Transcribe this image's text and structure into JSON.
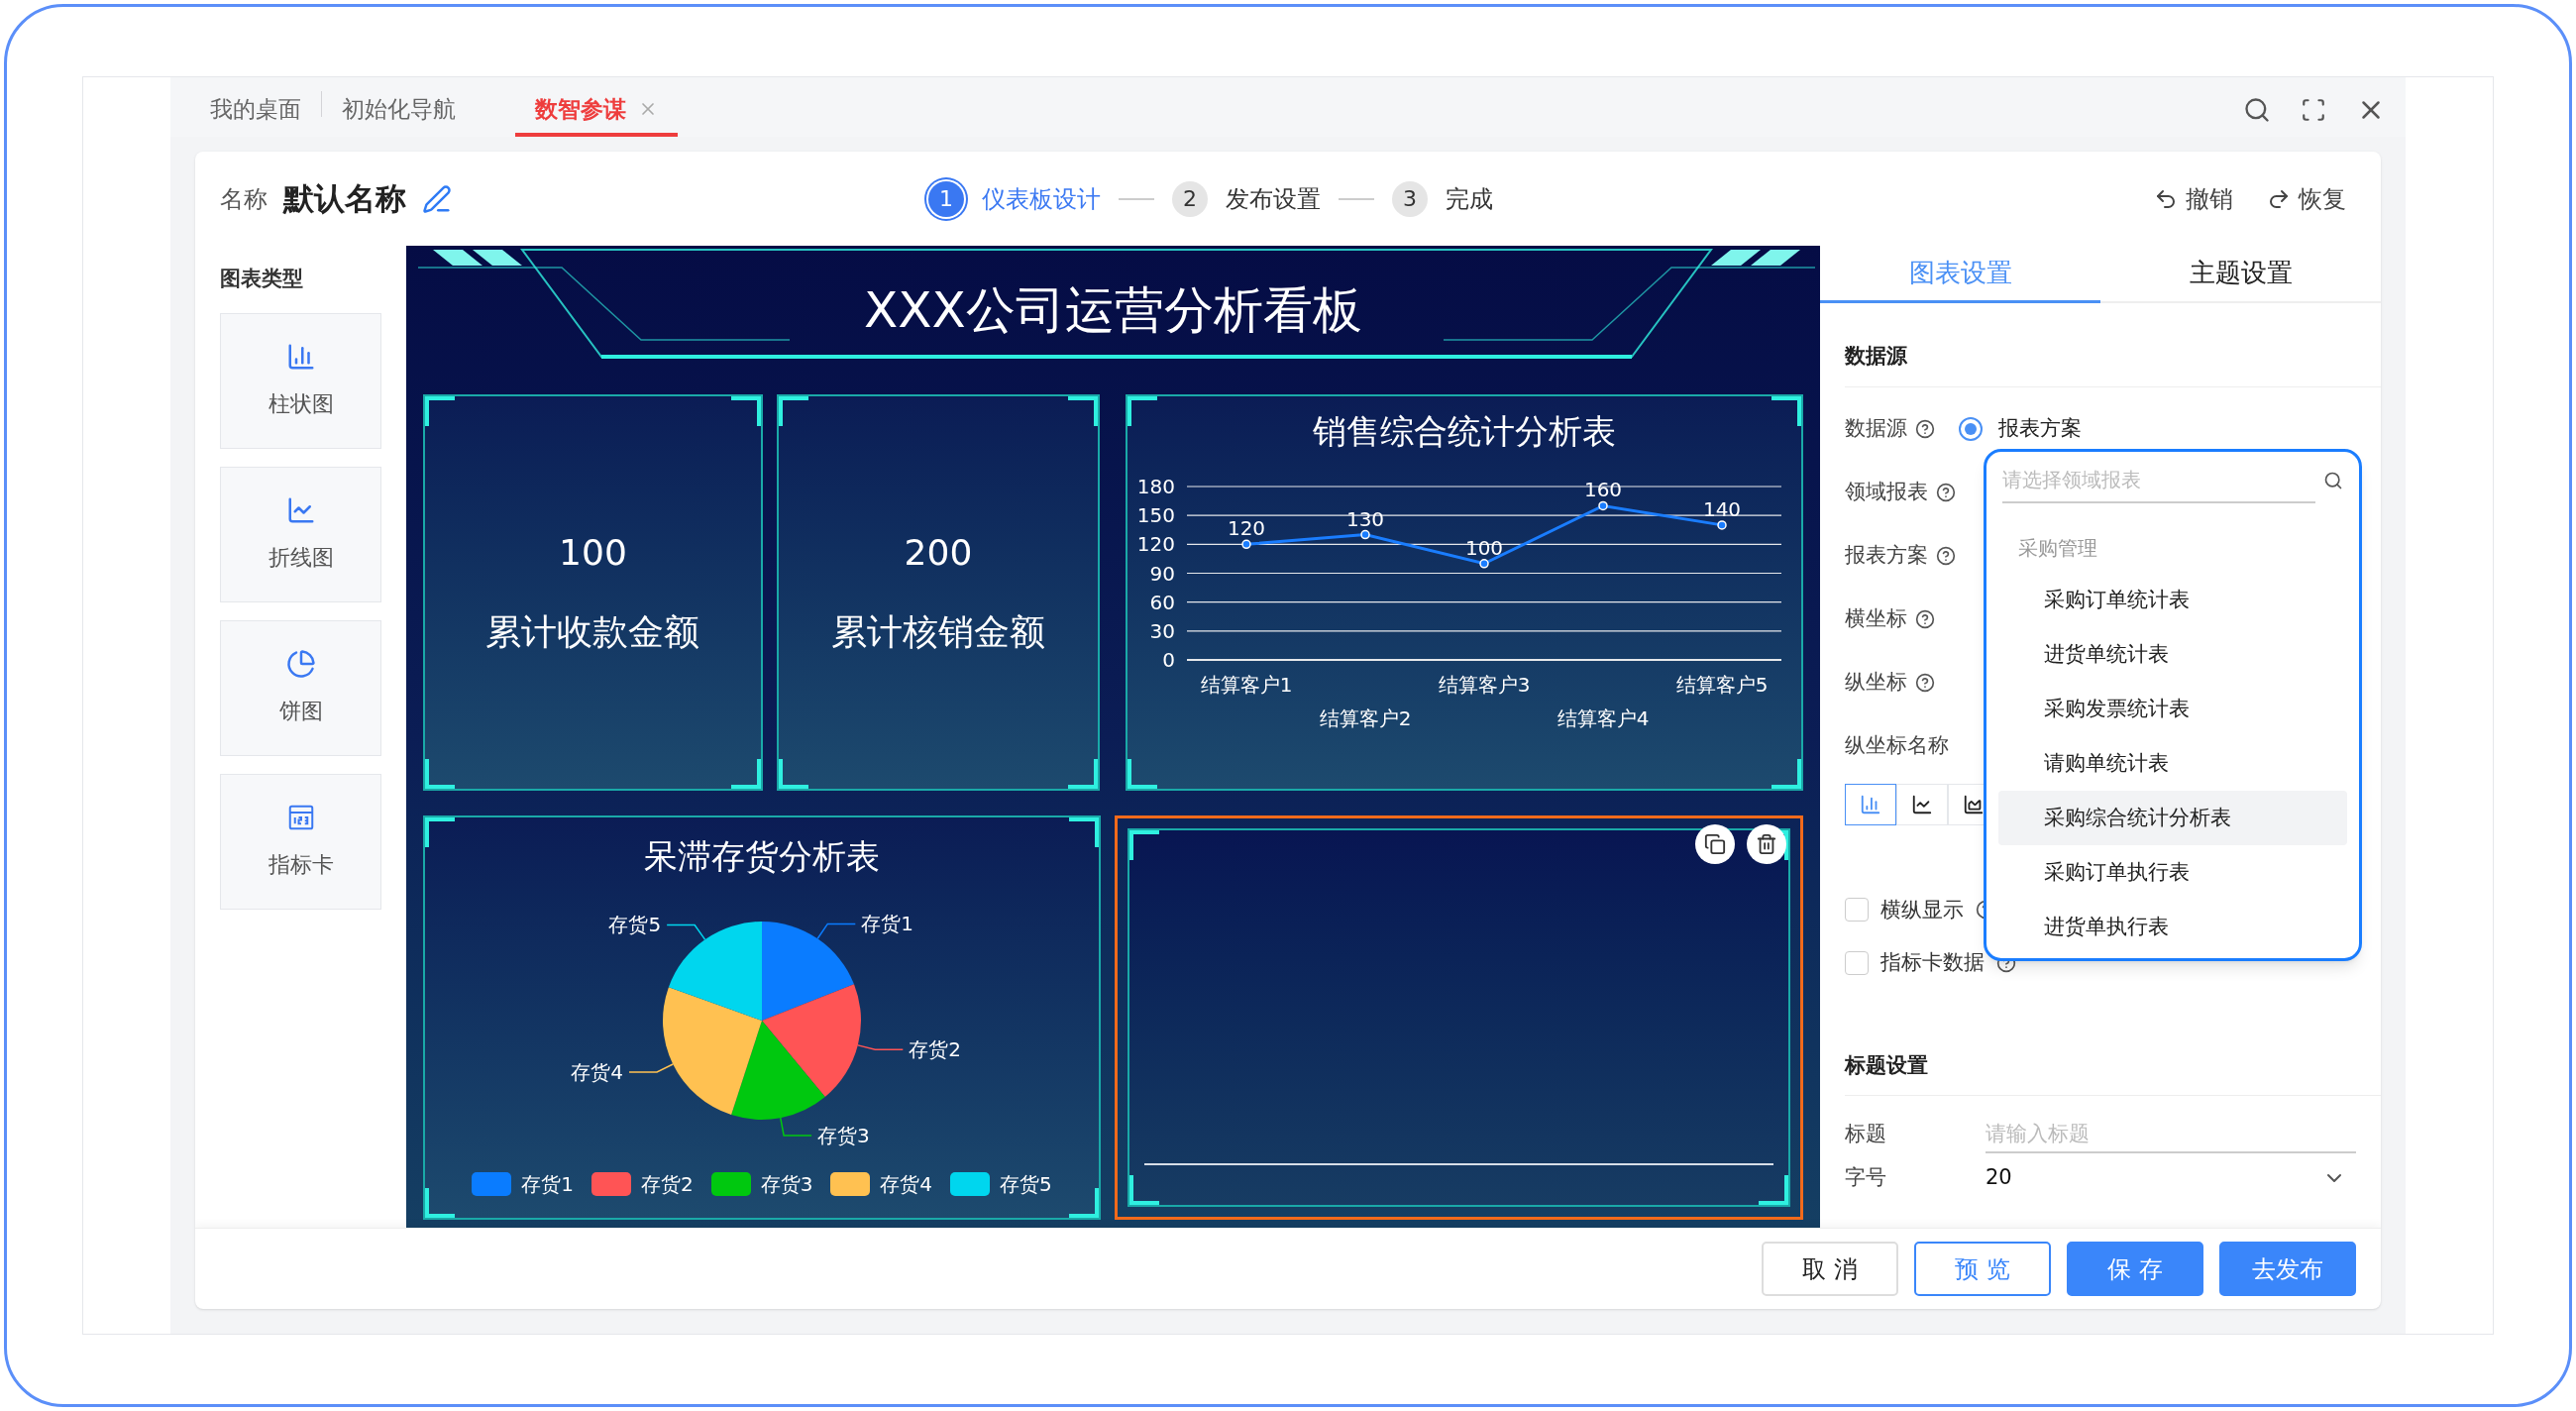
{
  "tabs": [
    {
      "label": "我的桌面",
      "selected": false
    },
    {
      "label": "初始化导航",
      "selected": false
    },
    {
      "label": "数智参谋",
      "selected": true
    }
  ],
  "header": {
    "name_label": "名称",
    "name_value": "默认名称",
    "steps": [
      {
        "number": "1",
        "label": "仪表板设计",
        "selected": true
      },
      {
        "number": "2",
        "label": "发布设置",
        "selected": false
      },
      {
        "number": "3",
        "label": "完成",
        "selected": false
      }
    ],
    "actions": [
      {
        "kind": "undo",
        "label": "撤销"
      },
      {
        "kind": "redo",
        "label": "恢复"
      }
    ]
  },
  "sidebar": {
    "title": "图表类型",
    "items": [
      {
        "kind": "bar",
        "label": "柱状图"
      },
      {
        "kind": "line",
        "label": "折线图"
      },
      {
        "kind": "pie",
        "label": "饼图"
      },
      {
        "kind": "card",
        "label": "指标卡"
      }
    ]
  },
  "dashboard": {
    "title": "XXX公司运营分析看板",
    "cards": [
      {
        "value": "100",
        "label": "累计收款金额"
      },
      {
        "value": "200",
        "label": "累计核销金额"
      }
    ],
    "line_chart": {
      "chart_data": {
        "type": "line",
        "title": "销售综合统计分析表",
        "categories": [
          "结算客户1",
          "结算客户2",
          "结算客户3",
          "结算客户4",
          "结算客户5"
        ],
        "series": [
          {
            "color": "#1a7dff",
            "values": [
              120,
              130,
              100,
              160,
              140
            ]
          }
        ],
        "ylim": [
          0,
          180
        ],
        "yticks": [
          0,
          30,
          60,
          90,
          120,
          150,
          180
        ],
        "data_labels": true,
        "grid": true,
        "marker": true
      }
    },
    "pie_chart": {
      "title": "呆滞存货分析表",
      "slices": [
        {
          "label": "存货1",
          "color": "#0a7cff"
        },
        {
          "label": "存货2",
          "color": "#ff5455"
        },
        {
          "label": "存货3",
          "color": "#00c80f"
        },
        {
          "label": "存货4",
          "color": "#ffc151"
        },
        {
          "label": "存货5",
          "color": "#00d6ee"
        }
      ],
      "legend": [
        {
          "label": "存货1",
          "color": "#0a7cff"
        },
        {
          "label": "存货2",
          "color": "#ff5455"
        },
        {
          "label": "存货3",
          "color": "#00c80f"
        },
        {
          "label": "存货4",
          "color": "#ffc151"
        },
        {
          "label": "存货5",
          "color": "#00d6ee"
        }
      ]
    },
    "empty_panel": {
      "selected": true
    }
  },
  "settings": {
    "tabs": [
      {
        "label": "图表设置",
        "selected": true
      },
      {
        "label": "主题设置",
        "selected": false
      }
    ],
    "section": "数据源",
    "fields": [
      {
        "label": "数据源",
        "help": true,
        "kind": "radio",
        "option": "报表方案",
        "checked": true
      },
      {
        "label": "领域报表",
        "help": true,
        "kind": "select"
      },
      {
        "label": "报表方案",
        "help": true,
        "kind": "select"
      },
      {
        "label": "横坐标",
        "help": true,
        "kind": "select"
      },
      {
        "label": "纵坐标",
        "help": true,
        "kind": "select"
      },
      {
        "label": "纵坐标名称",
        "help": false,
        "kind": "select"
      }
    ],
    "chart_types": [
      {
        "kind": "bar",
        "selected": true
      },
      {
        "kind": "line",
        "selected": false
      },
      {
        "kind": "area",
        "selected": false
      }
    ],
    "checkboxes": [
      {
        "label": "横纵显示",
        "checked": false,
        "help": true
      },
      {
        "label": "指标卡数据",
        "checked": false,
        "help": true
      }
    ],
    "title_section": "标题设置",
    "title_field": {
      "label": "标题",
      "placeholder": "请输入标题"
    },
    "font_size": {
      "label": "字号",
      "value": "20"
    }
  },
  "dropdown": {
    "placeholder": "请选择领域报表",
    "group": "采购管理",
    "items": [
      {
        "label": "采购订单统计表",
        "selected": false
      },
      {
        "label": "进货单统计表",
        "selected": false
      },
      {
        "label": "采购发票统计表",
        "selected": false
      },
      {
        "label": "请购单统计表",
        "selected": false
      },
      {
        "label": "采购综合统计分析表",
        "selected": true
      },
      {
        "label": "采购订单执行表",
        "selected": false
      },
      {
        "label": "进货单执行表",
        "selected": false
      }
    ]
  },
  "footer_buttons": [
    {
      "label": "取 消",
      "kind": "default"
    },
    {
      "label": "预 览",
      "kind": "outline"
    },
    {
      "label": "保 存",
      "kind": "primary"
    },
    {
      "label": "去发布",
      "kind": "primary"
    }
  ]
}
